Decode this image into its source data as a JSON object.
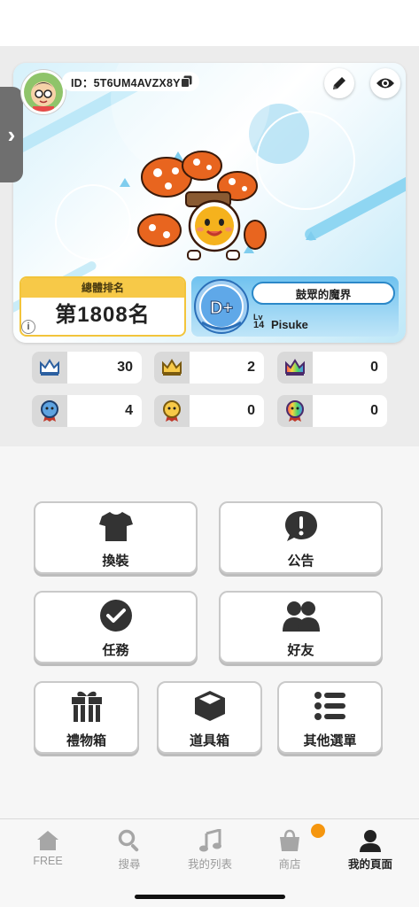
{
  "profile": {
    "id_label": "ID：5T6UM4AVZX8Y",
    "rank_header": "總體排名",
    "rank_value": "第1808名",
    "info_label": "i",
    "title": "鼓眾的魔界",
    "dan_label": "D+",
    "level_prefix": "Lv",
    "level": "14",
    "player_name": "Pisuke"
  },
  "stats": [
    {
      "icon": "crown-silver-icon",
      "value": "30"
    },
    {
      "icon": "crown-gold-icon",
      "value": "2"
    },
    {
      "icon": "crown-rainbow-icon",
      "value": "0"
    },
    {
      "icon": "medal-silver-icon",
      "value": "4"
    },
    {
      "icon": "medal-gold-icon",
      "value": "0"
    },
    {
      "icon": "medal-rainbow-icon",
      "value": "0"
    }
  ],
  "menu": {
    "costume": "換裝",
    "announcement": "公告",
    "mission": "任務",
    "friends": "好友",
    "gift_box": "禮物箱",
    "item_box": "道具箱",
    "other_menu": "其他選單"
  },
  "tabs": [
    {
      "label": "FREE",
      "icon": "home-icon"
    },
    {
      "label": "搜尋",
      "icon": "search-icon"
    },
    {
      "label": "我的列表",
      "icon": "music-note-icon"
    },
    {
      "label": "商店",
      "icon": "shopping-bag-icon"
    },
    {
      "label": "我的頁面",
      "icon": "user-icon"
    }
  ],
  "colors": {
    "accent_yellow": "#f7c948",
    "accent_blue": "#2b88c8",
    "notification": "#f5960f"
  }
}
